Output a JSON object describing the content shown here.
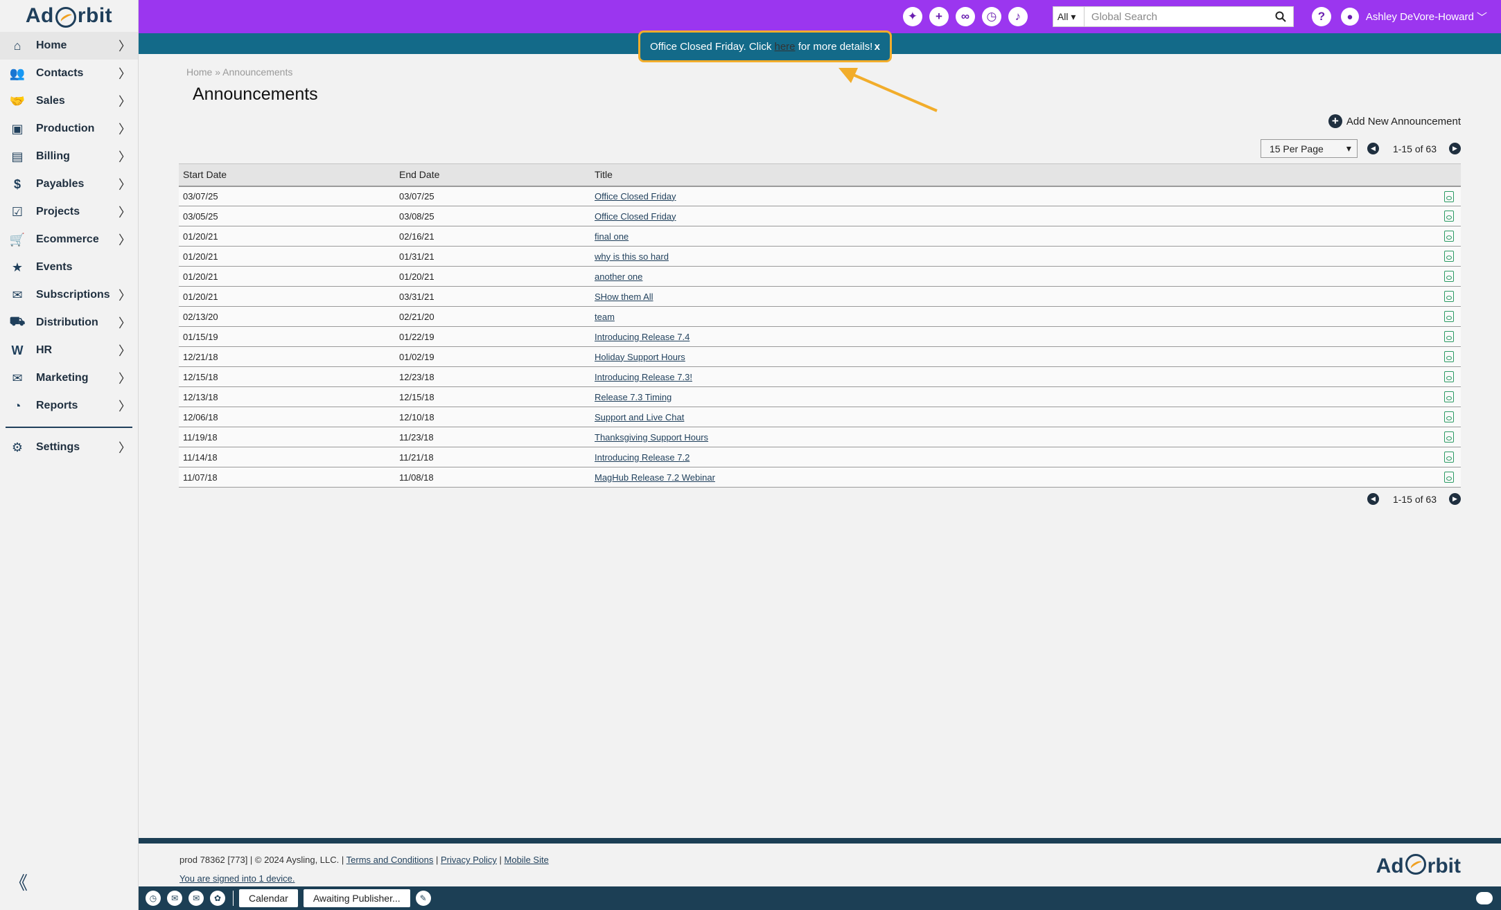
{
  "brand": {
    "logo_left": "Ad",
    "logo_right": "rbit"
  },
  "sidebar": {
    "items": [
      {
        "label": "Home",
        "icon": "home-icon",
        "glyph": "⌂",
        "chevron": "〉",
        "active": true
      },
      {
        "label": "Contacts",
        "icon": "contacts-icon",
        "glyph": "👥",
        "chevron": "〉"
      },
      {
        "label": "Sales",
        "icon": "handshake-icon",
        "glyph": "🤝",
        "chevron": "〉"
      },
      {
        "label": "Production",
        "icon": "image-icon",
        "glyph": "▣",
        "chevron": "〉"
      },
      {
        "label": "Billing",
        "icon": "invoice-icon",
        "glyph": "▤",
        "chevron": "〉"
      },
      {
        "label": "Payables",
        "icon": "money-icon",
        "glyph": "$",
        "chevron": "〉"
      },
      {
        "label": "Projects",
        "icon": "clipboard-icon",
        "glyph": "☑",
        "chevron": "〉"
      },
      {
        "label": "Ecommerce",
        "icon": "cart-icon",
        "glyph": "🛒",
        "chevron": "〉"
      },
      {
        "label": "Events",
        "icon": "calendar-star-icon",
        "glyph": "★",
        "chevron": ""
      },
      {
        "label": "Subscriptions",
        "icon": "mailbox-icon",
        "glyph": "✉",
        "chevron": "〉"
      },
      {
        "label": "Distribution",
        "icon": "truck-icon",
        "glyph": "⛟",
        "chevron": "〉"
      },
      {
        "label": "HR",
        "icon": "w2-form-icon",
        "glyph": "W",
        "chevron": "〉"
      },
      {
        "label": "Marketing",
        "icon": "envelope-icon",
        "glyph": "✉",
        "chevron": "〉"
      },
      {
        "label": "Reports",
        "icon": "chart-icon",
        "glyph": "◔",
        "chevron": "〉"
      }
    ],
    "settings": {
      "label": "Settings",
      "icon": "gear-icon",
      "glyph": "⚙",
      "chevron": "〉"
    },
    "collapse_glyph": "《"
  },
  "topbar": {
    "icons": [
      {
        "name": "party-icon",
        "glyph": "✦"
      },
      {
        "name": "plus-icon",
        "glyph": "+"
      },
      {
        "name": "link-icon",
        "glyph": "∞"
      },
      {
        "name": "history-icon",
        "glyph": "◷"
      },
      {
        "name": "bell-icon",
        "glyph": "♪"
      }
    ],
    "search_scope": "All",
    "search_placeholder": "Global Search",
    "help_glyph": "?",
    "user_name": "Ashley DeVore-Howard",
    "user_chevron": "﹀"
  },
  "banner": {
    "text_before": "Office Closed Friday. Click ",
    "link_text": "here",
    "text_after": " for more details!",
    "close": "x"
  },
  "page": {
    "breadcrumb_home": "Home",
    "breadcrumb_sep": " » ",
    "breadcrumb_current": "Announcements",
    "title": "Announcements",
    "add_new_label": "Add New Announcement",
    "per_page": "15 Per Page",
    "range": "1-15 of 63"
  },
  "table": {
    "headers": [
      "Start Date",
      "End Date",
      "Title"
    ],
    "rows": [
      [
        "03/07/25",
        "03/07/25",
        "Office Closed Friday"
      ],
      [
        "03/05/25",
        "03/08/25",
        "Office Closed Friday"
      ],
      [
        "01/20/21",
        "02/16/21",
        "final one"
      ],
      [
        "01/20/21",
        "01/31/21",
        "why is this so hard"
      ],
      [
        "01/20/21",
        "01/20/21",
        "another one"
      ],
      [
        "01/20/21",
        "03/31/21",
        "SHow them All"
      ],
      [
        "02/13/20",
        "02/21/20",
        "team"
      ],
      [
        "01/15/19",
        "01/22/19",
        "Introducing Release 7.4"
      ],
      [
        "12/21/18",
        "01/02/19",
        "Holiday Support Hours"
      ],
      [
        "12/15/18",
        "12/23/18",
        "Introducing Release 7.3!"
      ],
      [
        "12/13/18",
        "12/15/18",
        "Release 7.3 Timing"
      ],
      [
        "12/06/18",
        "12/10/18",
        "Support and Live Chat"
      ],
      [
        "11/19/18",
        "11/23/18",
        "Thanksgiving Support Hours"
      ],
      [
        "11/14/18",
        "11/21/18",
        "Introducing Release 7.2"
      ],
      [
        "11/07/18",
        "11/08/18",
        "MagHub Release 7.2 Webinar"
      ]
    ]
  },
  "footer": {
    "info": "prod 78362 [773] | © 2024 Aysling, LLC. | ",
    "terms": "Terms and Conditions",
    "sep": " | ",
    "privacy": "Privacy Policy",
    "mobile": "Mobile Site",
    "signed_in": "You are signed into 1 device."
  },
  "taskbar": {
    "icons": [
      {
        "name": "clock-icon",
        "glyph": "◷"
      },
      {
        "name": "mail-icon",
        "glyph": "✉"
      },
      {
        "name": "mail-open-icon",
        "glyph": "✉"
      },
      {
        "name": "apps-icon",
        "glyph": "✿"
      }
    ],
    "calendar_label": "Calendar",
    "awaiting_label": "Awaiting Publisher...",
    "edit_glyph": "✎"
  },
  "colors": {
    "topbar": "#9b36ef",
    "banner": "#136a89",
    "highlight": "#f2ad2b",
    "navy": "#1c3f55"
  }
}
